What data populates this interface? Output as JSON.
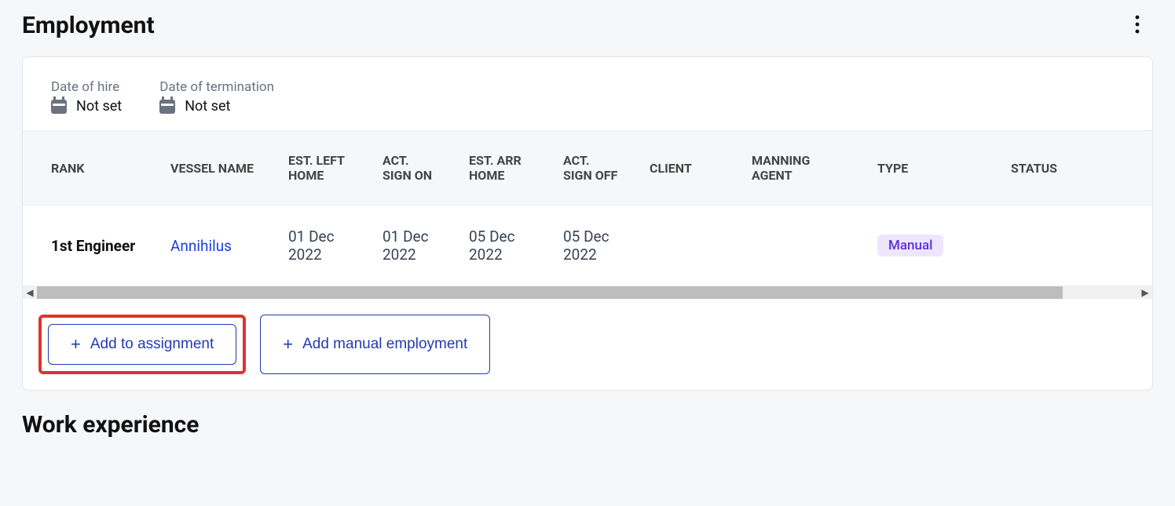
{
  "section": {
    "title": "Employment",
    "info": {
      "hire_label": "Date of hire",
      "hire_value": "Not set",
      "term_label": "Date of termination",
      "term_value": "Not set"
    },
    "columns": {
      "rank": "RANK",
      "vessel": "VESSEL NAME",
      "est_left": "EST. LEFT HOME",
      "act_sign_on": "ACT. SIGN ON",
      "est_arr": "EST. ARR HOME",
      "act_sign_off": "ACT. SIGN OFF",
      "client": "CLIENT",
      "manning_agent": "MANNING AGENT",
      "type": "TYPE",
      "status": "STATUS"
    },
    "rows": [
      {
        "rank": "1st Engineer",
        "vessel": "Annihilus",
        "est_left": "01 Dec 2022",
        "act_sign_on": "01 Dec 2022",
        "est_arr": "05 Dec 2022",
        "act_sign_off": "05 Dec 2022",
        "client": "",
        "manning_agent": "",
        "type": "Manual",
        "status": ""
      }
    ],
    "actions": {
      "add_assignment": "Add to assignment",
      "add_manual": "Add manual employment"
    }
  },
  "next_section_title": "Work experience"
}
